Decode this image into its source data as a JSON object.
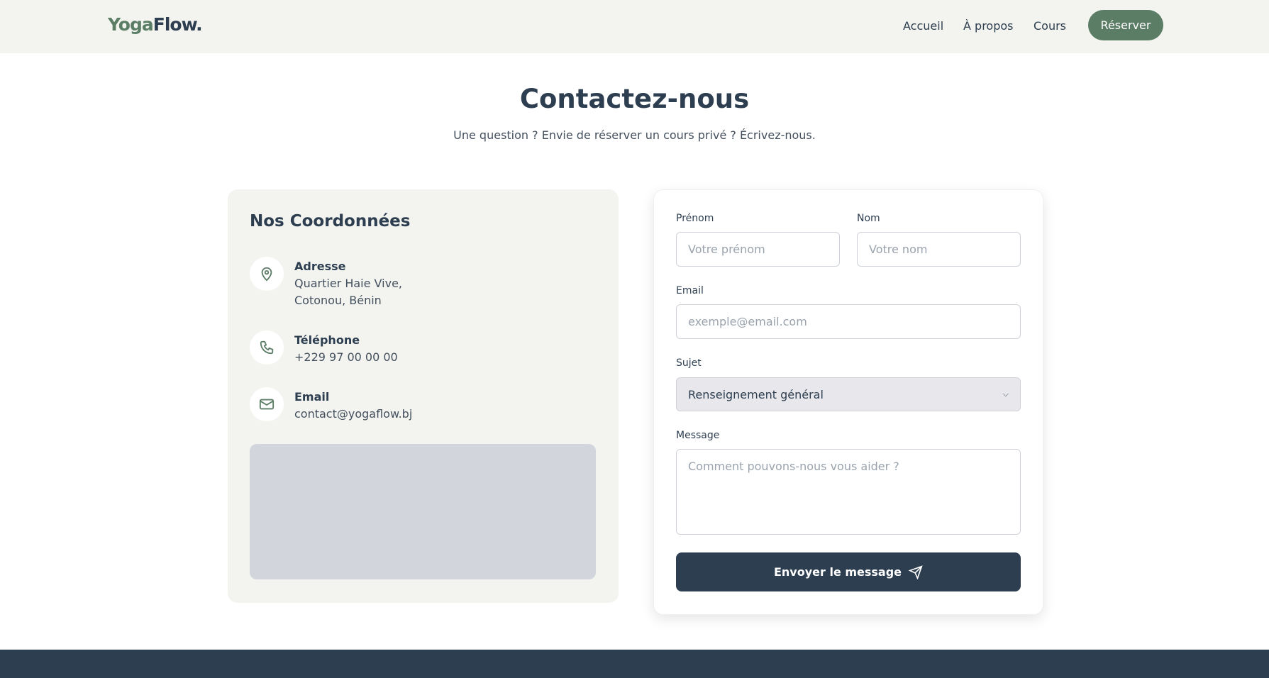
{
  "header": {
    "logo_part1": "Yoga",
    "logo_part2": "Flow.",
    "nav": [
      "Accueil",
      "À propos",
      "Cours"
    ],
    "cta": "Réserver"
  },
  "hero": {
    "title": "Contactez-nous",
    "subtitle": "Une question ? Envie de réserver un cours privé ? Écrivez-nous."
  },
  "contact": {
    "title": "Nos Coordonnées",
    "items": [
      {
        "icon": "map-pin-icon",
        "label": "Adresse",
        "line1": "Quartier Haie Vive,",
        "line2": "Cotonou, Bénin"
      },
      {
        "icon": "phone-icon",
        "label": "Téléphone",
        "line1": "+229 97 00 00 00"
      },
      {
        "icon": "mail-icon",
        "label": "Email",
        "line1": "contact@yogaflow.bj"
      }
    ]
  },
  "form": {
    "first_label": "Prénom",
    "first_placeholder": "Votre prénom",
    "last_label": "Nom",
    "last_placeholder": "Votre nom",
    "email_label": "Email",
    "email_placeholder": "exemple@email.com",
    "subject_label": "Sujet",
    "subject_value": "Renseignement général",
    "message_label": "Message",
    "message_placeholder": "Comment pouvons-nous vous aider ?",
    "submit": "Envoyer le message"
  },
  "colors": {
    "accent": "#5b7d66",
    "dark": "#2d3e50",
    "beige": "#f3f4ef"
  }
}
